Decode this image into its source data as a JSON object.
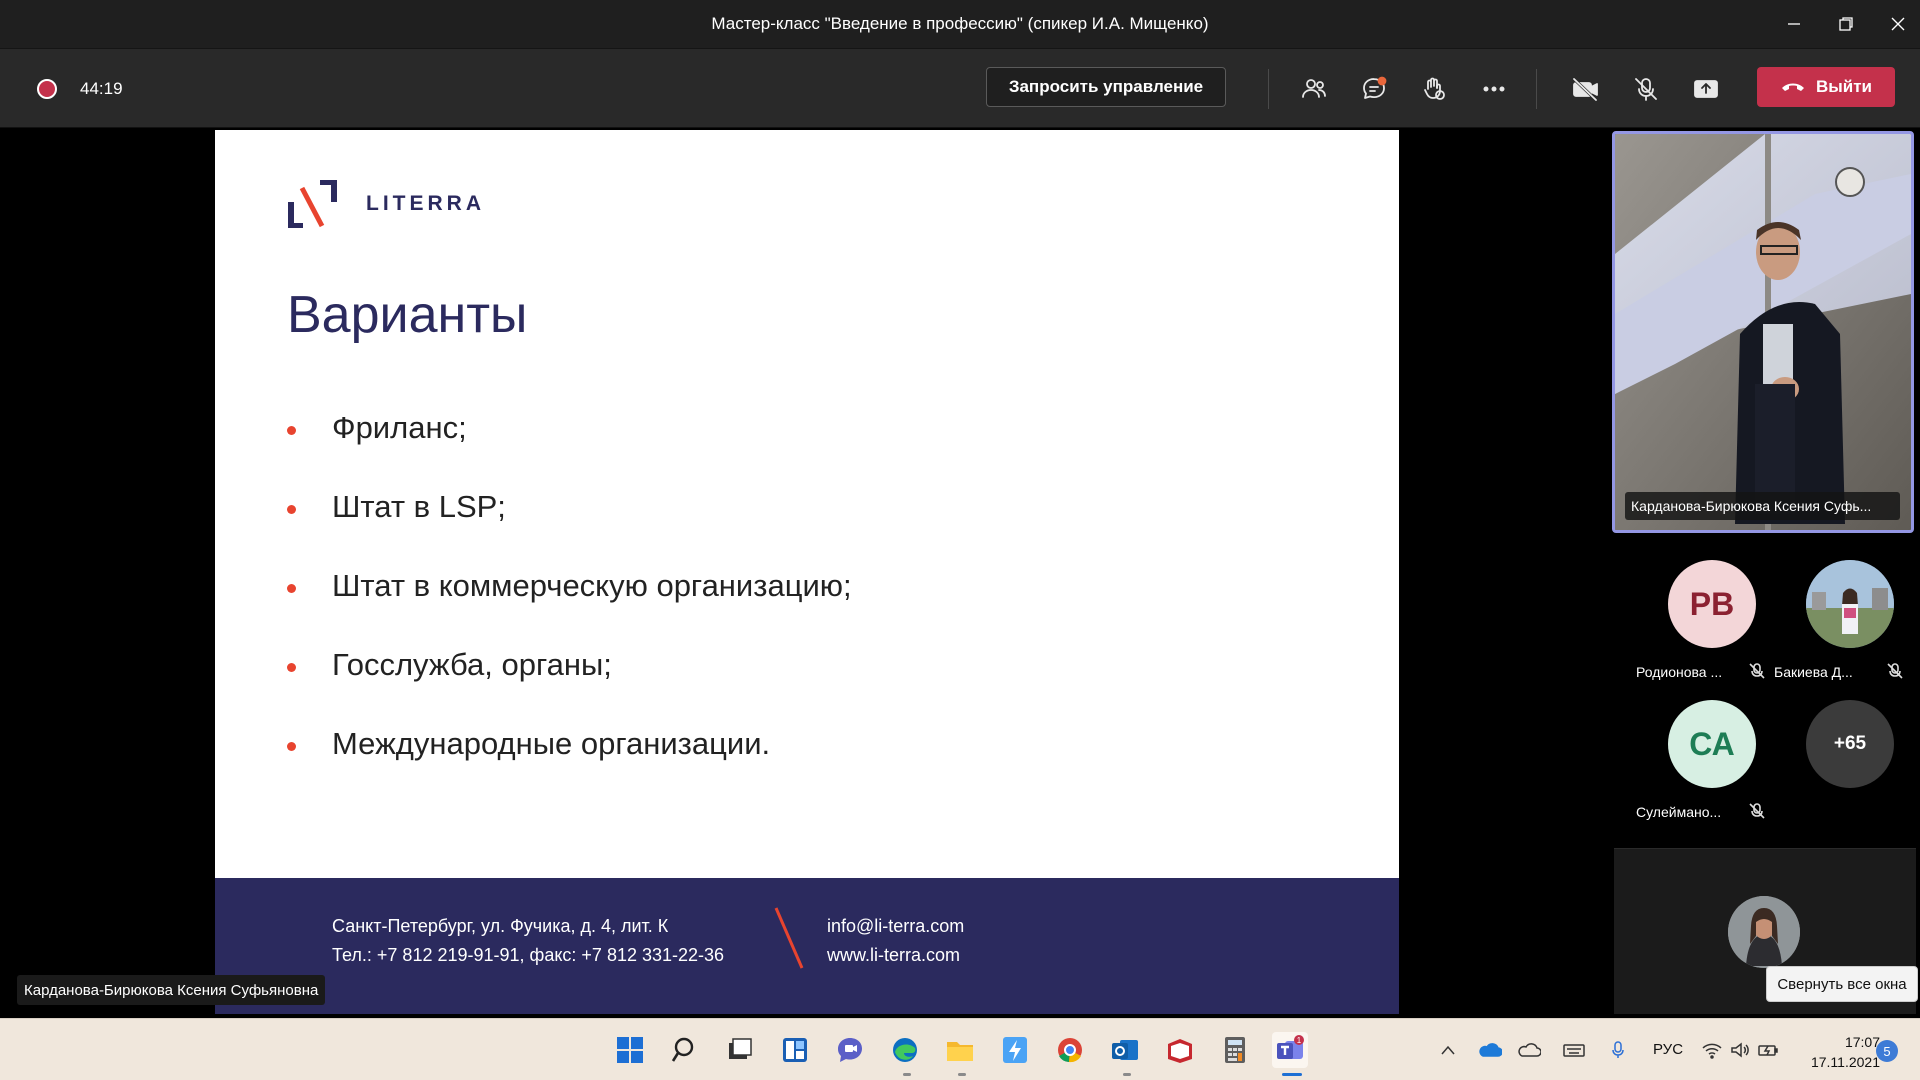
{
  "window": {
    "title": "Мастер-класс \"Введение в профессию\" (спикер И.А. Мищенко)"
  },
  "toolbar": {
    "timer": "44:19",
    "request_control_label": "Запросить управление",
    "leave_label": "Выйти",
    "leave_color": "#c4314b"
  },
  "slide": {
    "logo_text": "LITERRA",
    "title": "Варианты",
    "bullets": [
      "Фриланс;",
      "Штат в LSP;",
      "Штат в коммерческую организацию;",
      "Госслужба, органы;",
      "Международные организации."
    ],
    "footer": {
      "address": "Санкт-Петербург, ул. Фучика, д. 4, лит. К",
      "phones": "Тел.: +7 812 219-91-91, факс: +7 812 331-22-36",
      "email": "info@li-terra.com",
      "website": "www.li-terra.com"
    },
    "brand_color": "#2b2a5e",
    "accent_color": "#e8442f"
  },
  "stage": {
    "presenter_name": "Карданова-Бирюкова Ксения Суфьяновна"
  },
  "participants": {
    "video_name": "Карданова-Бирюкова Ксения Суфь...",
    "tiles": [
      {
        "initials": "РВ",
        "name": "Родионова ...",
        "muted": true
      },
      {
        "initials": "",
        "name": "Бакиева Д...",
        "muted": true
      },
      {
        "initials": "СА",
        "name": "Сулеймано...",
        "muted": true
      }
    ],
    "overflow_count": "+65",
    "tooltip": "Свернуть все окна"
  },
  "taskbar": {
    "language": "РУС",
    "time": "17:07",
    "date": "17.11.2021",
    "notification_count": "5",
    "teams_badge": "1"
  }
}
